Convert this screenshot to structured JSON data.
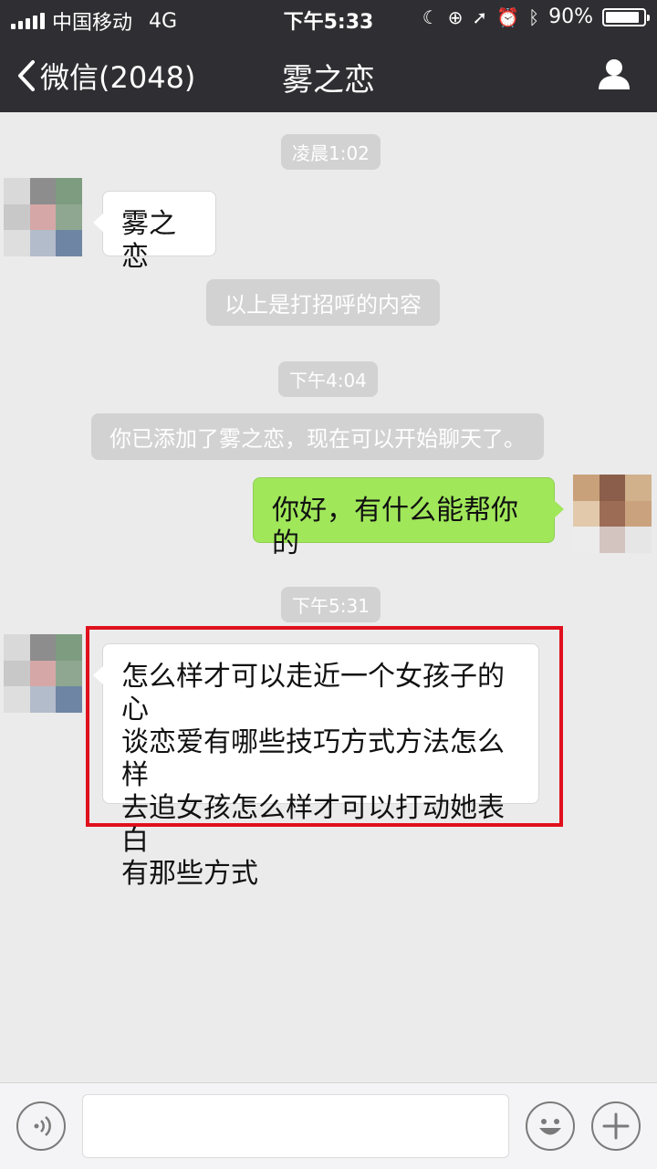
{
  "status_bar": {
    "carrier": "中国移动",
    "network": "4G",
    "time": "下午5:33",
    "battery_text": "90%",
    "battery_level": 0.9
  },
  "nav": {
    "back_label": "微信(2048)",
    "title": "雾之恋"
  },
  "chat": {
    "time_1": "凌晨1:02",
    "msg_1": "雾之恋",
    "system_1": "以上是打招呼的内容",
    "time_2": "下午4:04",
    "system_2": "你已添加了雾之恋，现在可以开始聊天了。",
    "msg_2": "你好，有什么能帮你的",
    "time_3": "下午5:31",
    "msg_3_lines": [
      "怎么样才可以走近一个女孩子的心",
      "谈恋爱有哪些技巧方式方法怎么样",
      "去追女孩怎么样才可以打动她表白",
      "有那些方式"
    ]
  },
  "input_bar": {
    "voice_icon": "voice-icon",
    "emoji_icon": "emoji-icon",
    "plus_icon": "plus-icon"
  },
  "colors": {
    "header_bg": "#2f2f33",
    "chat_bg": "#ebebeb",
    "my_bubble": "#a0e75a",
    "highlight": "#e0101c"
  }
}
